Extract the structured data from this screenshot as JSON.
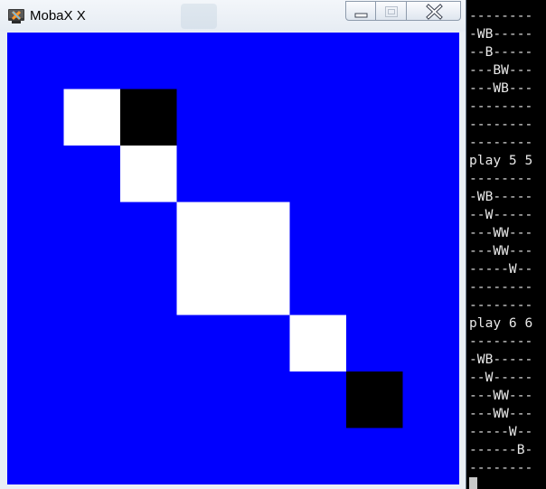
{
  "window": {
    "title": "MobaX X",
    "app_icon": "mobaxterm-x-icon",
    "buttons": {
      "minimize_icon": "minimize-icon",
      "maximize_icon": "maximize-icon",
      "close_icon": "close-icon"
    }
  },
  "board": {
    "background_color": "#0000ff",
    "white_color": "#ffffff",
    "black_color": "#000000",
    "grid_size": 8,
    "cells": [
      {
        "row": 1,
        "col": 1,
        "value": "W"
      },
      {
        "row": 1,
        "col": 2,
        "value": "B"
      },
      {
        "row": 2,
        "col": 2,
        "value": "W"
      },
      {
        "row": 3,
        "col": 3,
        "value": "W"
      },
      {
        "row": 3,
        "col": 4,
        "value": "W"
      },
      {
        "row": 4,
        "col": 3,
        "value": "W"
      },
      {
        "row": 4,
        "col": 4,
        "value": "W"
      },
      {
        "row": 5,
        "col": 5,
        "value": "W"
      },
      {
        "row": 6,
        "col": 6,
        "value": "B"
      }
    ]
  },
  "terminal": {
    "text_color": "#e8e8e8",
    "lines": [
      "--------",
      "-WB-----",
      "--B-----",
      "---BW---",
      "---WB---",
      "--------",
      "--------",
      "--------",
      "play 5 5",
      "--------",
      "-WB-----",
      "--W-----",
      "---WW---",
      "---WW---",
      "-----W--",
      "--------",
      "--------",
      "play 6 6",
      "--------",
      "-WB-----",
      "--W-----",
      "---WW---",
      "---WW---",
      "-----W--",
      "------B-",
      "--------"
    ]
  }
}
